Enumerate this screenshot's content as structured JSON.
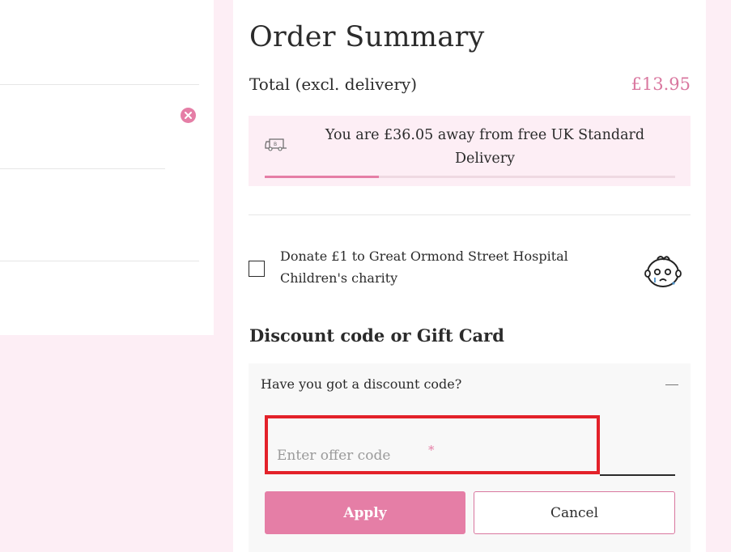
{
  "summary": {
    "title": "Order Summary",
    "total_label": "Total (excl. delivery)",
    "total_value": "£13.95"
  },
  "delivery": {
    "message": "You are £36.05 away from free UK Standard Delivery",
    "progress_fraction": 0.279,
    "icon": "delivery-van-icon"
  },
  "donation": {
    "label": "Donate £1 to Great Ormond Street Hospital Children's charity",
    "checked": false,
    "icon": "baby-face-icon"
  },
  "discount": {
    "heading": "Discount code or Gift Card",
    "question": "Have you got a discount code?",
    "input_placeholder": "Enter offer code",
    "input_value": "",
    "required_mark": "*",
    "apply_label": "Apply",
    "cancel_label": "Cancel"
  },
  "colors": {
    "accent": "#e57ea6",
    "accent_text": "#d9779f",
    "page_background": "#fdeef5",
    "highlight_border": "#e3222a"
  }
}
